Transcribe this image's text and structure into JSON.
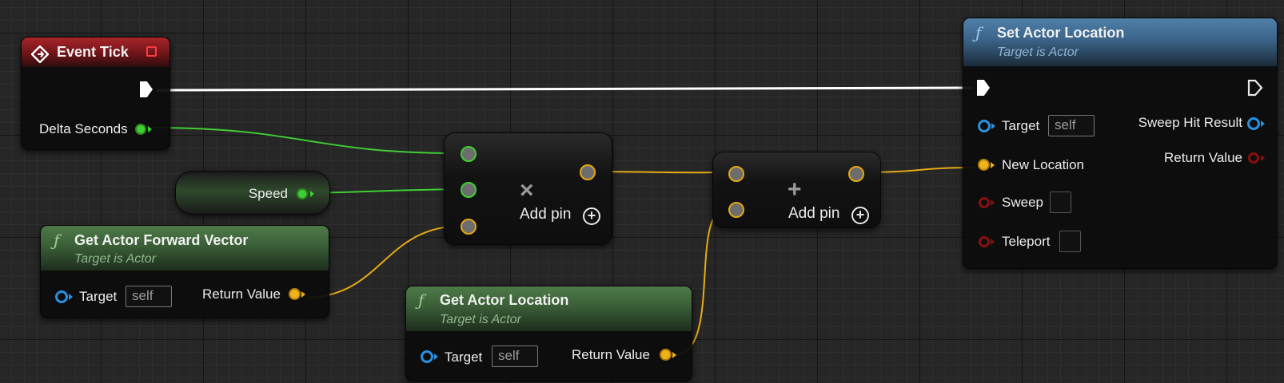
{
  "event_tick": {
    "title": "Event Tick",
    "pin_delta": "Delta Seconds"
  },
  "speed": {
    "label": "Speed"
  },
  "forward": {
    "title": "Get Actor Forward Vector",
    "subtitle": "Target is Actor",
    "target_label": "Target",
    "target_value": "self",
    "return_label": "Return Value"
  },
  "location": {
    "title": "Get Actor Location",
    "subtitle": "Target is Actor",
    "target_label": "Target",
    "target_value": "self",
    "return_label": "Return Value"
  },
  "multiply": {
    "symbol": "×",
    "add_pin": "Add pin",
    "add_symbol": "+"
  },
  "add": {
    "symbol": "+",
    "add_pin": "Add pin",
    "add_symbol": "+"
  },
  "set_location": {
    "title": "Set Actor Location",
    "subtitle": "Target is Actor",
    "target_label": "Target",
    "target_value": "self",
    "new_location_label": "New Location",
    "sweep_label": "Sweep",
    "teleport_label": "Teleport",
    "sweep_hit_label": "Sweep Hit Result",
    "return_label": "Return Value"
  },
  "icons": {
    "function_glyph": "ƒ"
  },
  "colors": {
    "float_pin": "#3fcf34",
    "vector_pin": "#f0b21a",
    "object_pin": "#2b8fe0",
    "bool_pin": "#8a1010",
    "exec_wire": "#ffffff",
    "event_header": "#a8242a",
    "pure_header": "#4d7a48",
    "func_header": "#4f7fa8"
  }
}
